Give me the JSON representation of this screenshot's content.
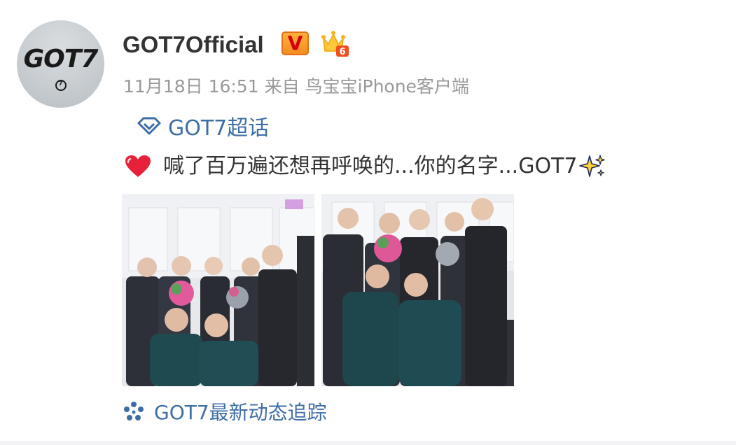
{
  "post": {
    "user": {
      "name": "GOT7Official",
      "avatar_text": "GOT7",
      "verified_badge": "V",
      "member_level": "6"
    },
    "meta": {
      "date": "11月18日 16:51",
      "from_label": "来自",
      "source": "鸟宝宝iPhone客户端"
    },
    "topic": {
      "icon": "super-topic-diamond-icon",
      "label": "GOT7超话"
    },
    "text": {
      "lead_icon": "red-heart-icon",
      "content": "喊了百万遍还想再呼唤的...你的名字...GOT7",
      "trail_icon": "sparkles-icon"
    },
    "photos": [
      {
        "alt": "group-photo-1"
      },
      {
        "alt": "group-photo-2"
      }
    ],
    "footer": {
      "icon": "blue-flower-icon",
      "label": "GOT7最新动态追踪"
    }
  },
  "colors": {
    "link": "#3e6ea6",
    "username": "#333333",
    "meta": "#999999",
    "verified_badge": "#f7a02a"
  }
}
